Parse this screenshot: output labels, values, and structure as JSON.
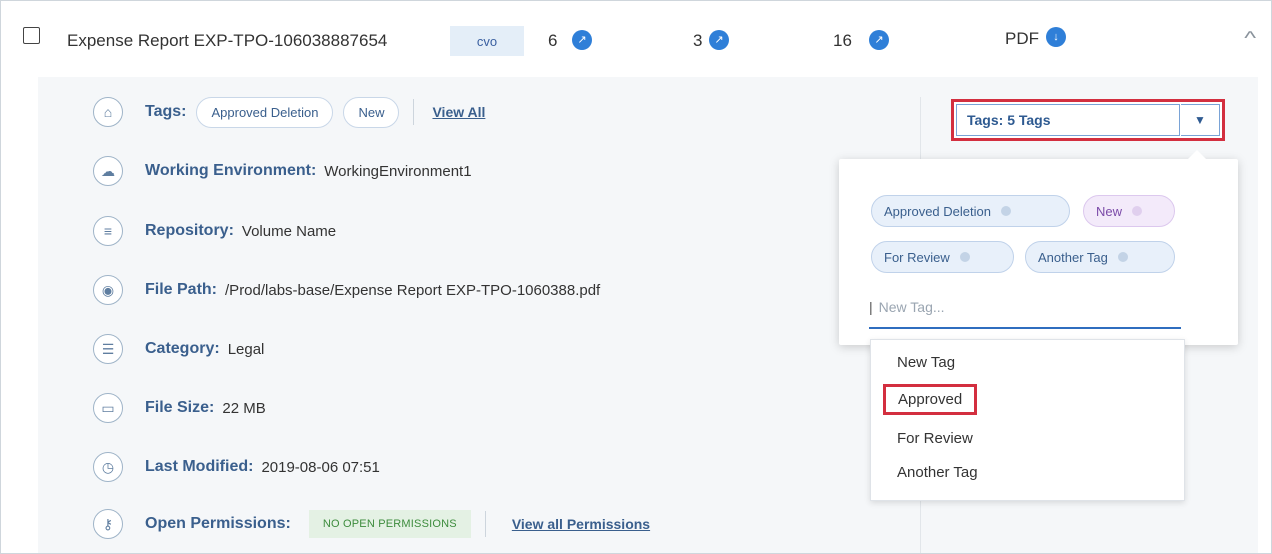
{
  "header": {
    "document_name": "Expense Report EXP-TPO-106038887654",
    "tag_badge": "cvo",
    "counts": [
      {
        "value": "6",
        "icon": "arrow-up-right-icon"
      },
      {
        "value": "3",
        "icon": "arrow-up-right-icon"
      },
      {
        "value": "16",
        "icon": "arrow-up-right-icon"
      }
    ],
    "file_type": "PDF",
    "file_type_icon": "download-icon",
    "collapse_icon": "chevron-up-icon"
  },
  "details": {
    "tags": {
      "label": "Tags:",
      "items": [
        "Approved Deletion",
        "New"
      ],
      "view_all": "View All"
    },
    "working_environment": {
      "label": "Working Environment:",
      "value": "WorkingEnvironment1"
    },
    "repository": {
      "label": "Repository:",
      "value": "Volume Name"
    },
    "file_path": {
      "label": "File Path:",
      "value": "/Prod/labs-base/Expense Report EXP-TPO-1060388.pdf"
    },
    "category": {
      "label": "Category:",
      "value": "Legal"
    },
    "file_size": {
      "label": "File Size:",
      "value": "22 MB"
    },
    "last_modified": {
      "label": "Last Modified:",
      "value": "2019-08-06 07:51"
    },
    "open_permissions": {
      "label": "Open Permissions:",
      "badge": "NO OPEN PERMISSIONS",
      "link": "View all Permissions"
    }
  },
  "tags_dropdown": {
    "selected_label": "Tags: 5 Tags",
    "applied_tags": [
      "Approved Deletion",
      "New",
      "For Review",
      "Another Tag"
    ],
    "input_placeholder": "New Tag...",
    "options": [
      "New Tag",
      "Approved",
      "For Review",
      "Another Tag"
    ],
    "highlighted_option": "Approved"
  },
  "colors": {
    "accent": "#2f7fd8",
    "label_blue": "#3a5f8d",
    "highlight_red": "#d32f3f",
    "panel_bg": "#f5f7f9",
    "permission_green": "#3d8c3d"
  }
}
